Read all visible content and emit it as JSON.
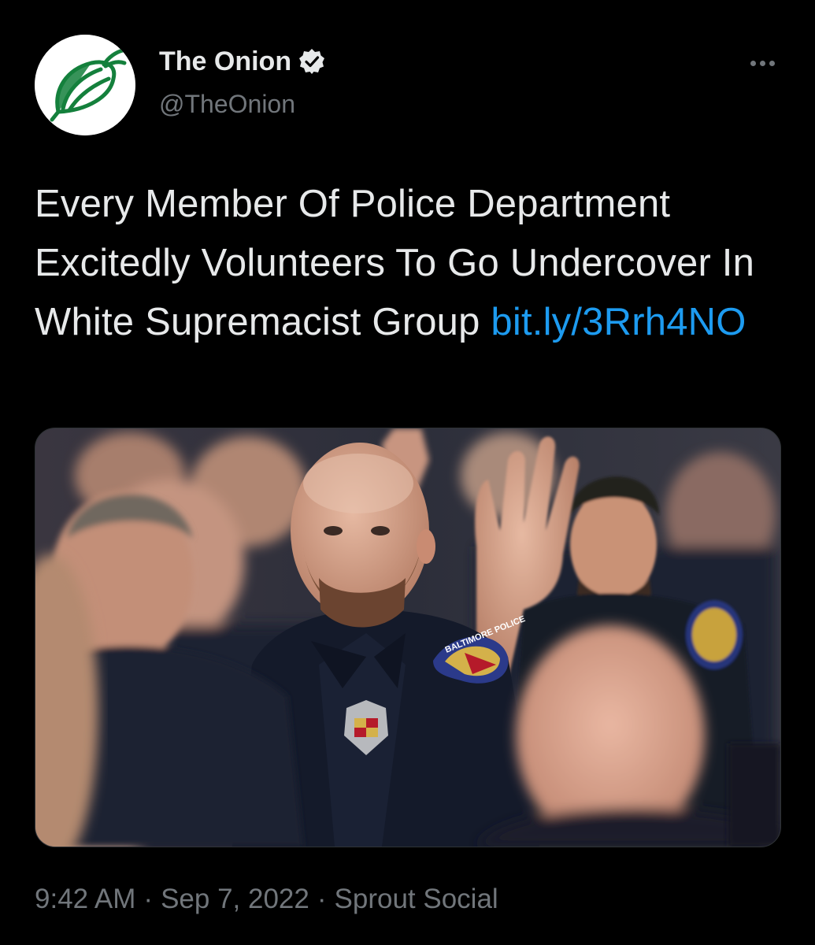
{
  "account": {
    "display_name": "The Onion",
    "handle": "@TheOnion",
    "avatar_icon": "onion-logo-icon",
    "verified_icon": "verified-badge-icon"
  },
  "tweet": {
    "text": "Every Member Of Police Department Excitedly Volunteers To Go Undercover In White Supremacist Group",
    "link": "bit.ly/3Rrh4NO",
    "media_badge_text": "BALTIMORE POLICE"
  },
  "meta": {
    "time": "9:42 AM",
    "date": "Sep 7, 2022",
    "source": "Sprout Social",
    "separator": "·"
  },
  "colors": {
    "background": "#000000",
    "text": "#e7e9ea",
    "secondary_text": "#71767b",
    "link": "#1d9bf0",
    "onion_green": "#14803c"
  },
  "icons": {
    "more": "more-options-icon"
  }
}
